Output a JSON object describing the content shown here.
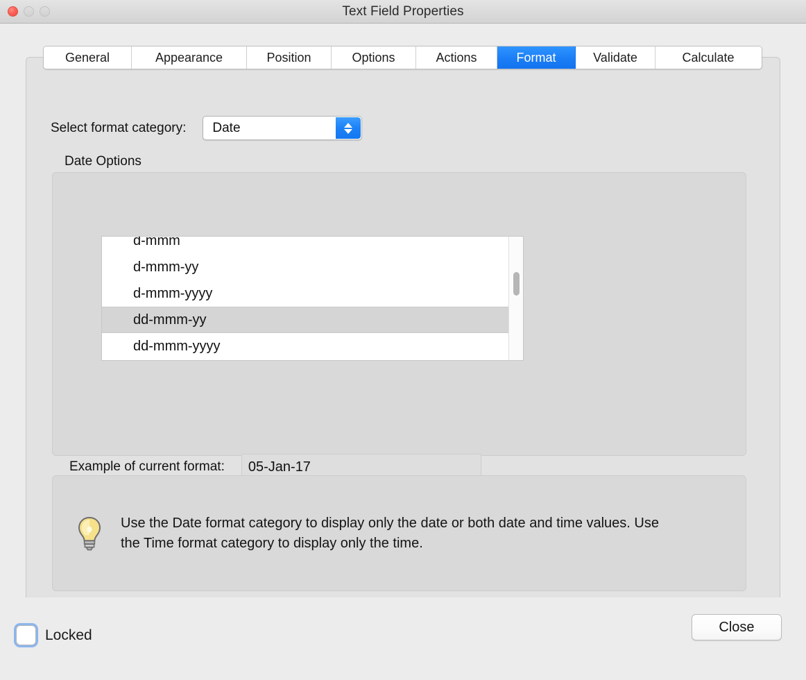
{
  "window": {
    "title": "Text Field Properties",
    "controls": {
      "close": "close-button",
      "minimize": "minimize-button",
      "maximize": "maximize-button"
    }
  },
  "tabs": [
    {
      "label": "General",
      "active": false
    },
    {
      "label": "Appearance",
      "active": false
    },
    {
      "label": "Position",
      "active": false
    },
    {
      "label": "Options",
      "active": false
    },
    {
      "label": "Actions",
      "active": false
    },
    {
      "label": "Format",
      "active": true
    },
    {
      "label": "Validate",
      "active": false
    },
    {
      "label": "Calculate",
      "active": false
    }
  ],
  "format": {
    "category_label": "Select format category:",
    "category_value": "Date",
    "group_title": "Date Options",
    "options": [
      {
        "label": "d-mmm",
        "selected": false,
        "clipped": true
      },
      {
        "label": "d-mmm-yy",
        "selected": false
      },
      {
        "label": "d-mmm-yyyy",
        "selected": false
      },
      {
        "label": "dd-mmm-yy",
        "selected": true
      },
      {
        "label": "dd-mmm-yyyy",
        "selected": false
      }
    ],
    "example_label": "Example of current format:",
    "example_value": "05-Jan-17"
  },
  "hint": {
    "icon": "lightbulb-icon",
    "text": "Use the Date format category to display only the date or both date and time values. Use the Time format category to display only the time."
  },
  "footer": {
    "locked_label": "Locked",
    "locked_checked": false,
    "close_label": "Close"
  },
  "colors": {
    "accent": "#1b7ef6",
    "window_bg": "#ececec",
    "panel_bg": "#e2e2e2",
    "group_bg": "#d9d9d9",
    "selection_bg": "#d5d5d5",
    "close_light": "#fb6158"
  }
}
